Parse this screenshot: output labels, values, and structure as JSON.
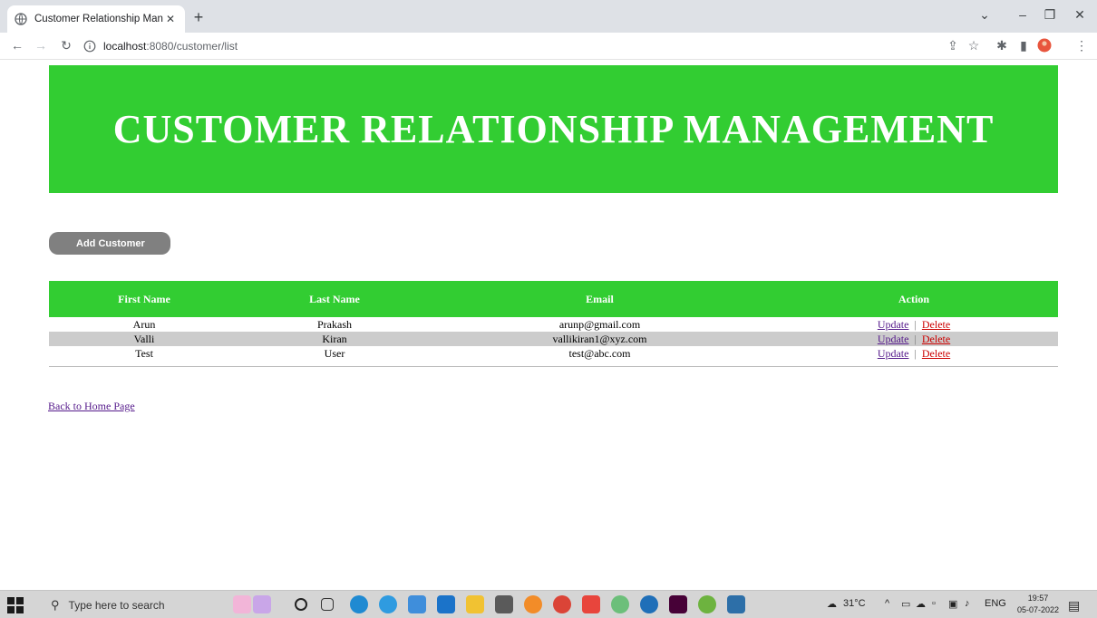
{
  "browser": {
    "tab_title": "Customer Relationship Managem",
    "tab_close": "✕",
    "new_tab": "+",
    "url_host": "localhost",
    "url_rest": ":8080/customer/list",
    "min_glyph": "–",
    "max_glyph": "❐",
    "close_glyph": "✕",
    "dropdown_glyph": "⌄"
  },
  "page": {
    "banner_title": "CUSTOMER RELATIONSHIP MANAGEMENT",
    "add_button": "Add Customer",
    "table": {
      "headers": [
        "First Name",
        "Last Name",
        "Email",
        "Action"
      ],
      "rows": [
        {
          "first": "Arun",
          "last": "Prakash",
          "email": "arunp@gmail.com",
          "update": "Update",
          "delete": "Delete"
        },
        {
          "first": "Valli",
          "last": "Kiran",
          "email": "vallikiran1@xyz.com",
          "update": "Update",
          "delete": "Delete"
        },
        {
          "first": "Test",
          "last": "User",
          "email": "test@abc.com",
          "update": "Update",
          "delete": "Delete"
        }
      ],
      "separator": "|"
    },
    "back_link": "Back to Home Page"
  },
  "taskbar": {
    "search_placeholder": "Type here to search",
    "weather": "31°C",
    "language": "ENG",
    "time": "19:57",
    "date": "05-07-2022"
  },
  "colors": {
    "accent_green": "#32cd32",
    "button_gray": "#808080",
    "alt_row": "#cccccc",
    "visited_link": "#551a8b",
    "delete_link": "#cc0000"
  }
}
